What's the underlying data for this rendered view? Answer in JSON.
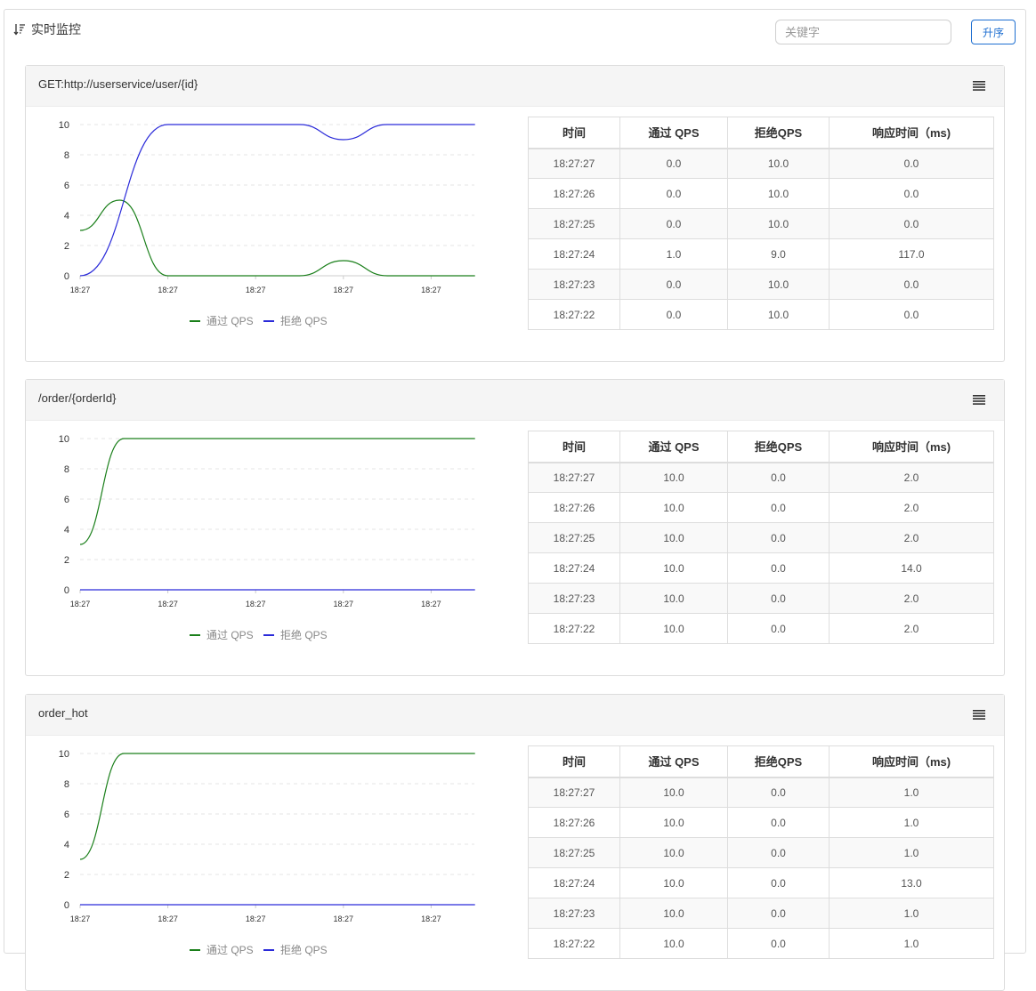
{
  "header": {
    "title": "实时监控",
    "search_placeholder": "关键字",
    "sort_label": "升序"
  },
  "colors": {
    "pass": "#1a7f1a",
    "block": "#2b2bd9",
    "accent": "#1e6fd1"
  },
  "icons": {
    "sort": "sort-descending-icon",
    "menu": "list-menu-icon"
  },
  "table_columns": [
    "时间",
    "通过 QPS",
    "拒绝QPS",
    "响应时间（ms)"
  ],
  "panels": [
    {
      "title": "GET:http://userservice/user/{id}",
      "rows": [
        [
          "18:27:27",
          "0.0",
          "10.0",
          "0.0"
        ],
        [
          "18:27:26",
          "0.0",
          "10.0",
          "0.0"
        ],
        [
          "18:27:25",
          "0.0",
          "10.0",
          "0.0"
        ],
        [
          "18:27:24",
          "1.0",
          "9.0",
          "117.0"
        ],
        [
          "18:27:23",
          "0.0",
          "10.0",
          "0.0"
        ],
        [
          "18:27:22",
          "0.0",
          "10.0",
          "0.0"
        ]
      ]
    },
    {
      "title": "/order/{orderId}",
      "rows": [
        [
          "18:27:27",
          "10.0",
          "0.0",
          "2.0"
        ],
        [
          "18:27:26",
          "10.0",
          "0.0",
          "2.0"
        ],
        [
          "18:27:25",
          "10.0",
          "0.0",
          "2.0"
        ],
        [
          "18:27:24",
          "10.0",
          "0.0",
          "14.0"
        ],
        [
          "18:27:23",
          "10.0",
          "0.0",
          "2.0"
        ],
        [
          "18:27:22",
          "10.0",
          "0.0",
          "2.0"
        ]
      ]
    },
    {
      "title": "order_hot",
      "rows": [
        [
          "18:27:27",
          "10.0",
          "0.0",
          "1.0"
        ],
        [
          "18:27:26",
          "10.0",
          "0.0",
          "1.0"
        ],
        [
          "18:27:25",
          "10.0",
          "0.0",
          "1.0"
        ],
        [
          "18:27:24",
          "10.0",
          "0.0",
          "13.0"
        ],
        [
          "18:27:23",
          "10.0",
          "0.0",
          "1.0"
        ],
        [
          "18:27:22",
          "10.0",
          "0.0",
          "1.0"
        ]
      ]
    }
  ],
  "chart_data": [
    {
      "type": "line",
      "x": [
        0,
        1,
        2,
        3,
        4,
        5
      ],
      "xticks": [
        "18:27",
        "18:27",
        "18:27",
        "18:27",
        "18:27",
        "18:27"
      ],
      "ylim": [
        0,
        10
      ],
      "yticks": [
        0,
        2,
        4,
        6,
        8,
        10
      ],
      "legend": "bottom-center",
      "grid": true,
      "series": [
        {
          "name": "通过 QPS",
          "values": [
            3,
            5,
            0,
            0,
            0,
            1,
            0,
            0,
            0
          ],
          "x": [
            0,
            0.45,
            1,
            1.5,
            2.5,
            3,
            3.5,
            4,
            4.5
          ]
        },
        {
          "name": "拒绝 QPS",
          "values": [
            0,
            10,
            10,
            10,
            9,
            10,
            10
          ],
          "x": [
            0,
            1,
            1.5,
            2.5,
            3,
            3.5,
            4.5
          ]
        }
      ]
    },
    {
      "type": "line",
      "x": [
        0,
        1,
        2,
        3,
        4,
        5
      ],
      "xticks": [
        "18:27",
        "18:27",
        "18:27",
        "18:27",
        "18:27",
        "18:27"
      ],
      "ylim": [
        0,
        10
      ],
      "yticks": [
        0,
        2,
        4,
        6,
        8,
        10
      ],
      "legend": "bottom-center",
      "grid": true,
      "series": [
        {
          "name": "通过 QPS",
          "values": [
            3,
            10,
            10,
            10,
            10,
            10
          ],
          "x": [
            0,
            0.5,
            1.5,
            2.5,
            3.5,
            4.5
          ]
        },
        {
          "name": "拒绝 QPS",
          "values": [
            0,
            0,
            0,
            0,
            0,
            0
          ],
          "x": [
            0,
            0.5,
            1.5,
            2.5,
            3.5,
            4.5
          ]
        }
      ]
    },
    {
      "type": "line",
      "x": [
        0,
        1,
        2,
        3,
        4,
        5
      ],
      "xticks": [
        "18:27",
        "18:27",
        "18:27",
        "18:27",
        "18:27",
        "18:27"
      ],
      "ylim": [
        0,
        10
      ],
      "yticks": [
        0,
        2,
        4,
        6,
        8,
        10
      ],
      "legend": "bottom-center",
      "grid": true,
      "series": [
        {
          "name": "通过 QPS",
          "values": [
            3,
            10,
            10,
            10,
            10,
            10
          ],
          "x": [
            0,
            0.5,
            1.5,
            2.5,
            3.5,
            4.5
          ]
        },
        {
          "name": "拒绝 QPS",
          "values": [
            0,
            0,
            0,
            0,
            0,
            0
          ],
          "x": [
            0,
            0.5,
            1.5,
            2.5,
            3.5,
            4.5
          ]
        }
      ]
    }
  ]
}
